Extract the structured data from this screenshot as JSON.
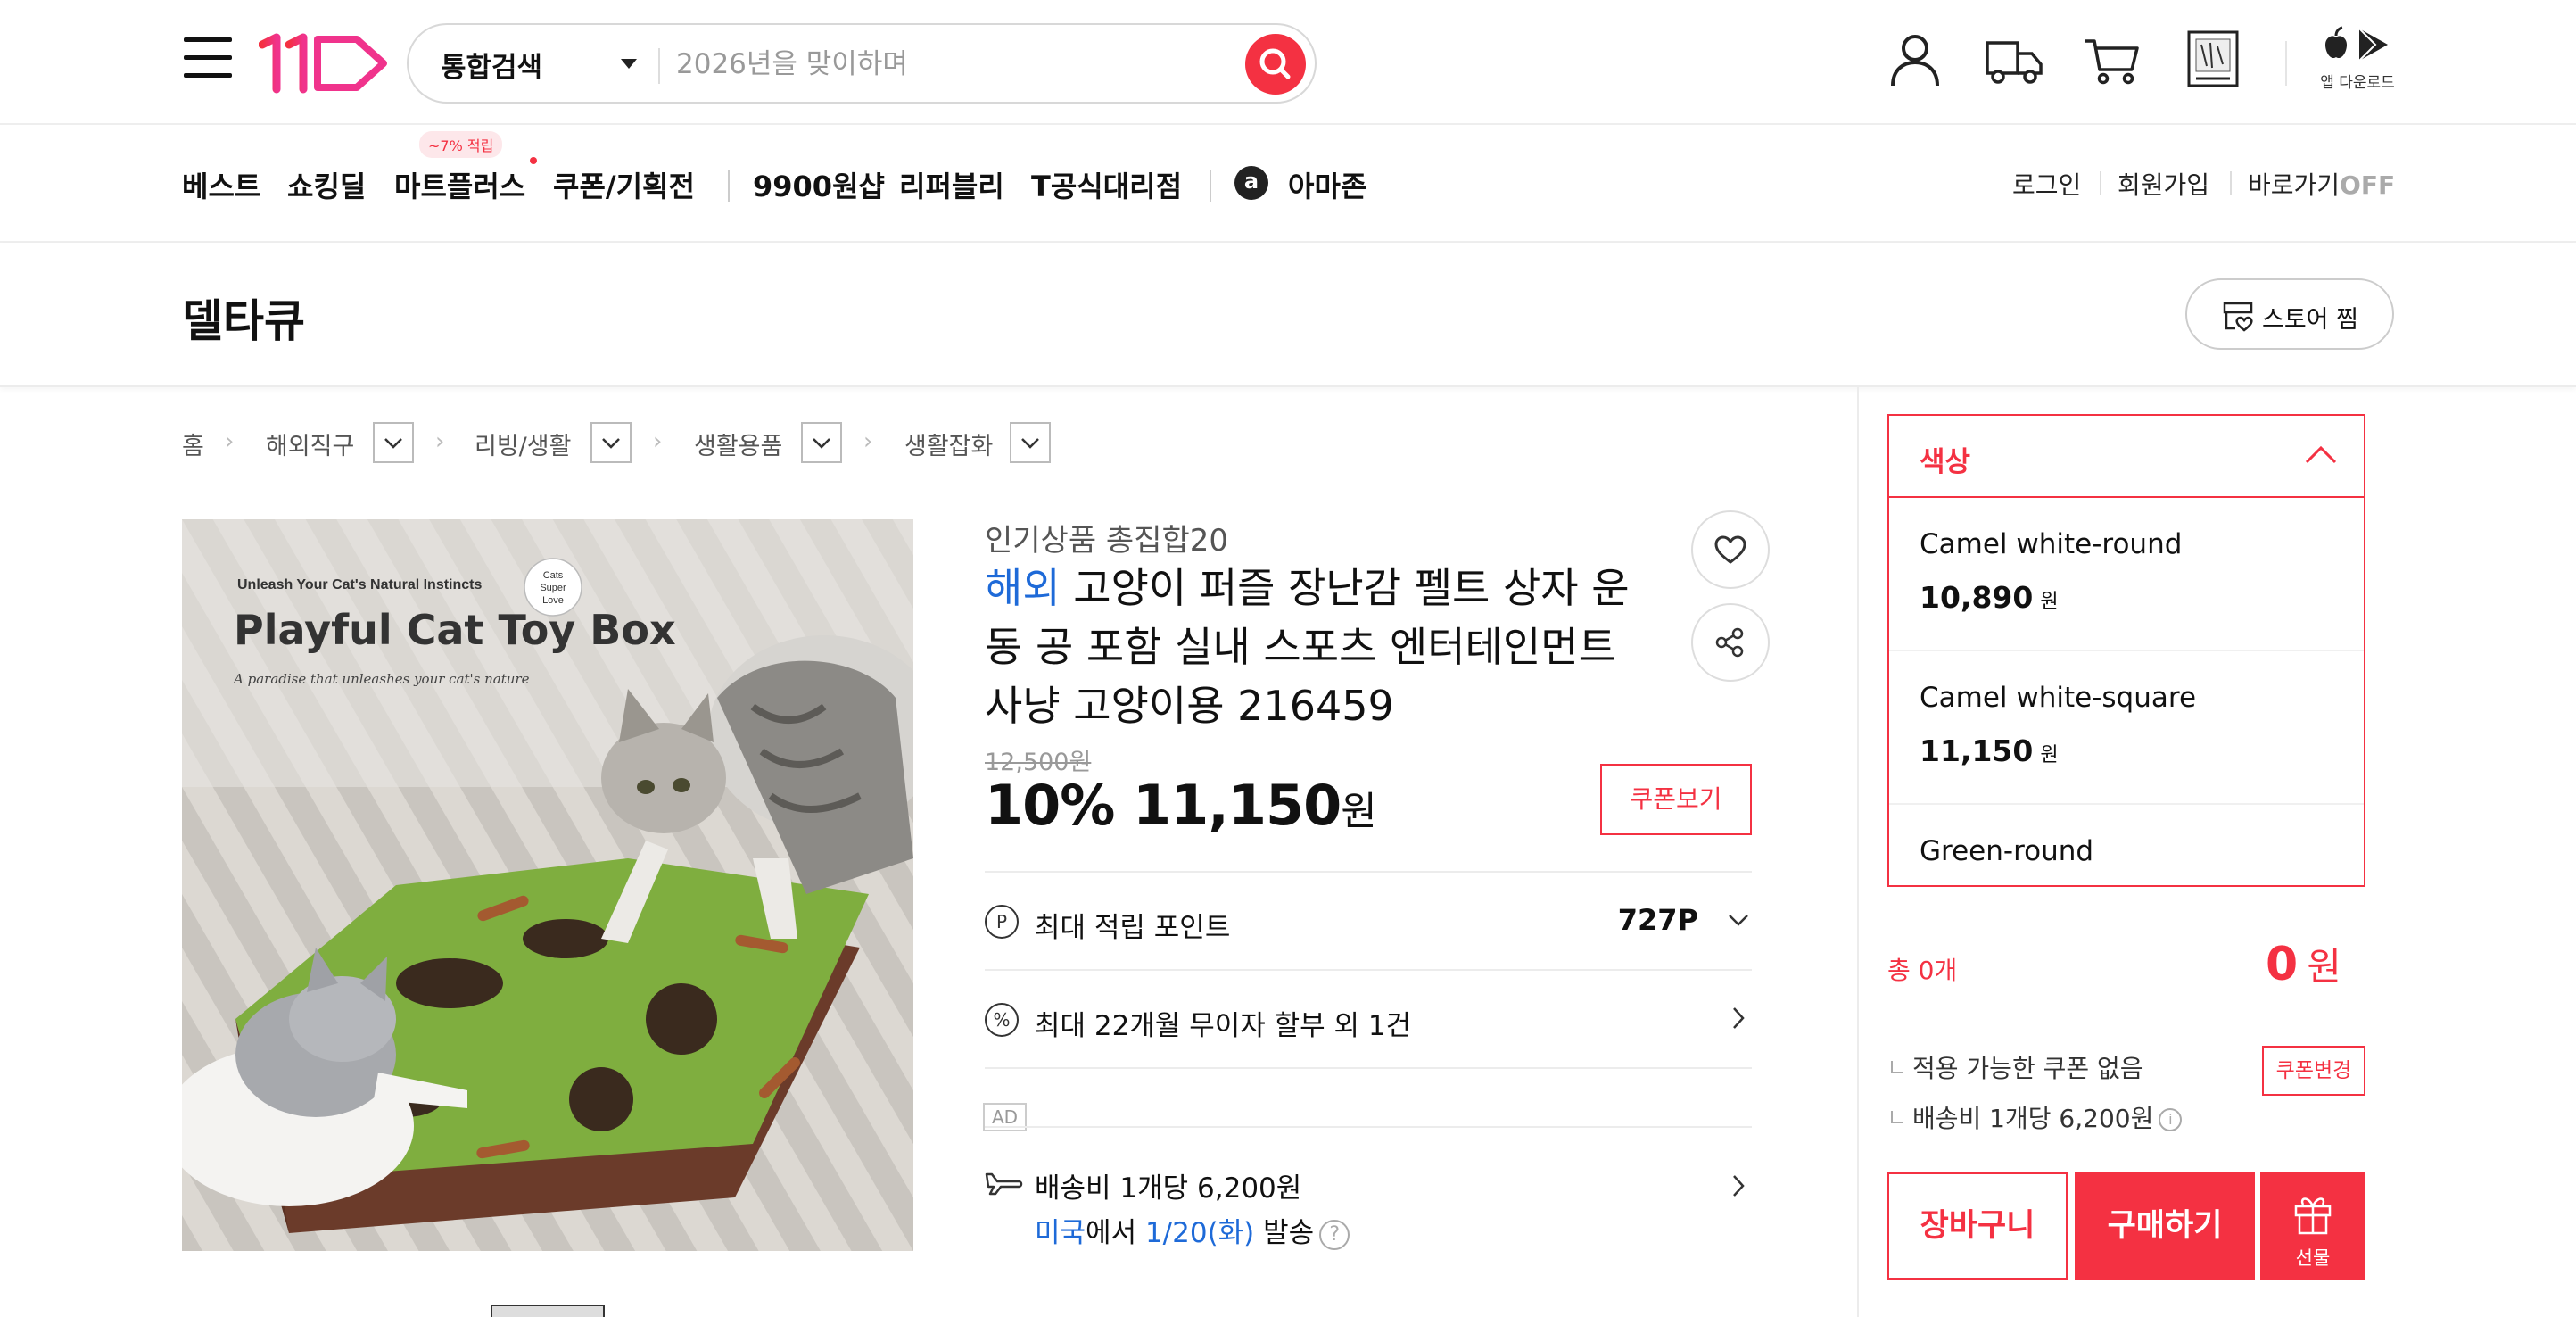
{
  "header": {
    "search_category": "통합검색",
    "search_placeholder": "2026년을 맞이하며",
    "app_download": "앱 다운로드"
  },
  "gnb": {
    "items": [
      "베스트",
      "쇼킹딜",
      "마트플러스",
      "쿠폰/기획전",
      "9900원샵",
      "리퍼블리",
      "T공식대리점",
      "아마존"
    ],
    "mart_badge": "~7% 적립",
    "amazon_icon_letter": "a",
    "login": "로그인",
    "signup": "회원가입",
    "shortcut": "바로가기",
    "shortcut_state": "OFF"
  },
  "store": {
    "name": "델타큐",
    "fav_label": "스토어 찜"
  },
  "breadcrumb": [
    "홈",
    "해외직구",
    "리빙/생활",
    "생활용품",
    "생활잡화"
  ],
  "product": {
    "image_texts": {
      "tagline": "Unleash Your Cat's Natural Instincts",
      "title": "Playful Cat Toy Box",
      "subtitle": "A paradise that unleashes your cat's nature",
      "badge": [
        "Cats",
        "Super",
        "Love"
      ]
    },
    "subtitle": "인기상품 총집합20",
    "overseas_tag": "해외",
    "title": "고양이 퍼즐 장난감 펠트 상자 운동 공 포함 실내 스포츠 엔터테인먼트 사냥 고양이용 216459",
    "original_price": "12,500원",
    "discount": "10%",
    "price": "11,150",
    "price_unit": "원",
    "coupon_button": "쿠폰보기",
    "points_label": "최대 적립 포인트",
    "points_value": "727P",
    "installment": "최대 22개월 무이자 할부 외 1건",
    "ad_tag": "AD",
    "shipping_fee": "배송비 1개당 6,200원",
    "ship_origin": "미국",
    "ship_origin_suffix": "에서",
    "ship_date": "1/20(화)",
    "ship_suffix": "발송"
  },
  "panel": {
    "option_header": "색상",
    "options": [
      {
        "name": "Camel white-round",
        "price": "10,890",
        "unit": "원"
      },
      {
        "name": "Camel white-square",
        "price": "11,150",
        "unit": "원"
      },
      {
        "name": "Green-round",
        "price": "",
        "unit": ""
      }
    ],
    "total_count": "총 0개",
    "total_price": "0",
    "total_unit": "원",
    "coupon_note": "적용 가능한 쿠폰 없음",
    "coupon_change": "쿠폰변경",
    "shipping_note": "배송비 1개당 6,200원",
    "cart_button": "장바구니",
    "buy_button": "구매하기",
    "gift_button": "선물"
  },
  "colors": {
    "accent": "#f43142",
    "overseas_blue": "#1e6ad8"
  }
}
